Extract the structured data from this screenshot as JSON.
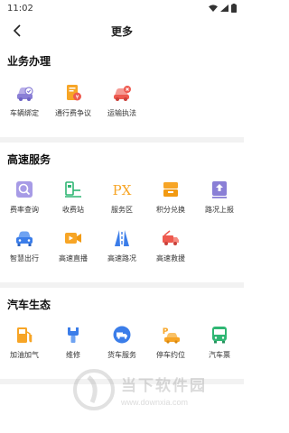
{
  "status_bar": {
    "time": "11:02"
  },
  "header": {
    "title": "更多"
  },
  "sections": [
    {
      "title": "业务办理",
      "items": [
        {
          "label": "车辆绑定",
          "icon": "car-bind-icon"
        },
        {
          "label": "通行费争议",
          "icon": "toll-dispute-icon"
        },
        {
          "label": "运输执法",
          "icon": "transport-enforcement-icon"
        }
      ]
    },
    {
      "title": "高速服务",
      "items": [
        {
          "label": "费率查询",
          "icon": "rate-query-icon"
        },
        {
          "label": "收费站",
          "icon": "toll-station-icon"
        },
        {
          "label": "服务区",
          "icon": "service-area-icon"
        },
        {
          "label": "积分兑换",
          "icon": "points-exchange-icon"
        },
        {
          "label": "路况上报",
          "icon": "road-report-icon"
        },
        {
          "label": "智慧出行",
          "icon": "smart-travel-icon"
        },
        {
          "label": "高速直播",
          "icon": "live-stream-icon"
        },
        {
          "label": "高速路况",
          "icon": "road-condition-icon"
        },
        {
          "label": "高速救援",
          "icon": "rescue-icon"
        }
      ]
    },
    {
      "title": "汽车生态",
      "items": [
        {
          "label": "加油加气",
          "icon": "fuel-icon"
        },
        {
          "label": "维修",
          "icon": "repair-icon"
        },
        {
          "label": "货车服务",
          "icon": "truck-service-icon"
        },
        {
          "label": "停车约位",
          "icon": "parking-icon"
        },
        {
          "label": "汽车票",
          "icon": "bus-ticket-icon"
        }
      ]
    }
  ],
  "watermark": {
    "name": "当下软件园",
    "url": "www.downxia.com"
  },
  "colors": {
    "orange": "#f7a526",
    "blue": "#3b7de9",
    "red": "#ee5a4f",
    "green": "#2fb673",
    "purple": "#8a7fd6"
  }
}
